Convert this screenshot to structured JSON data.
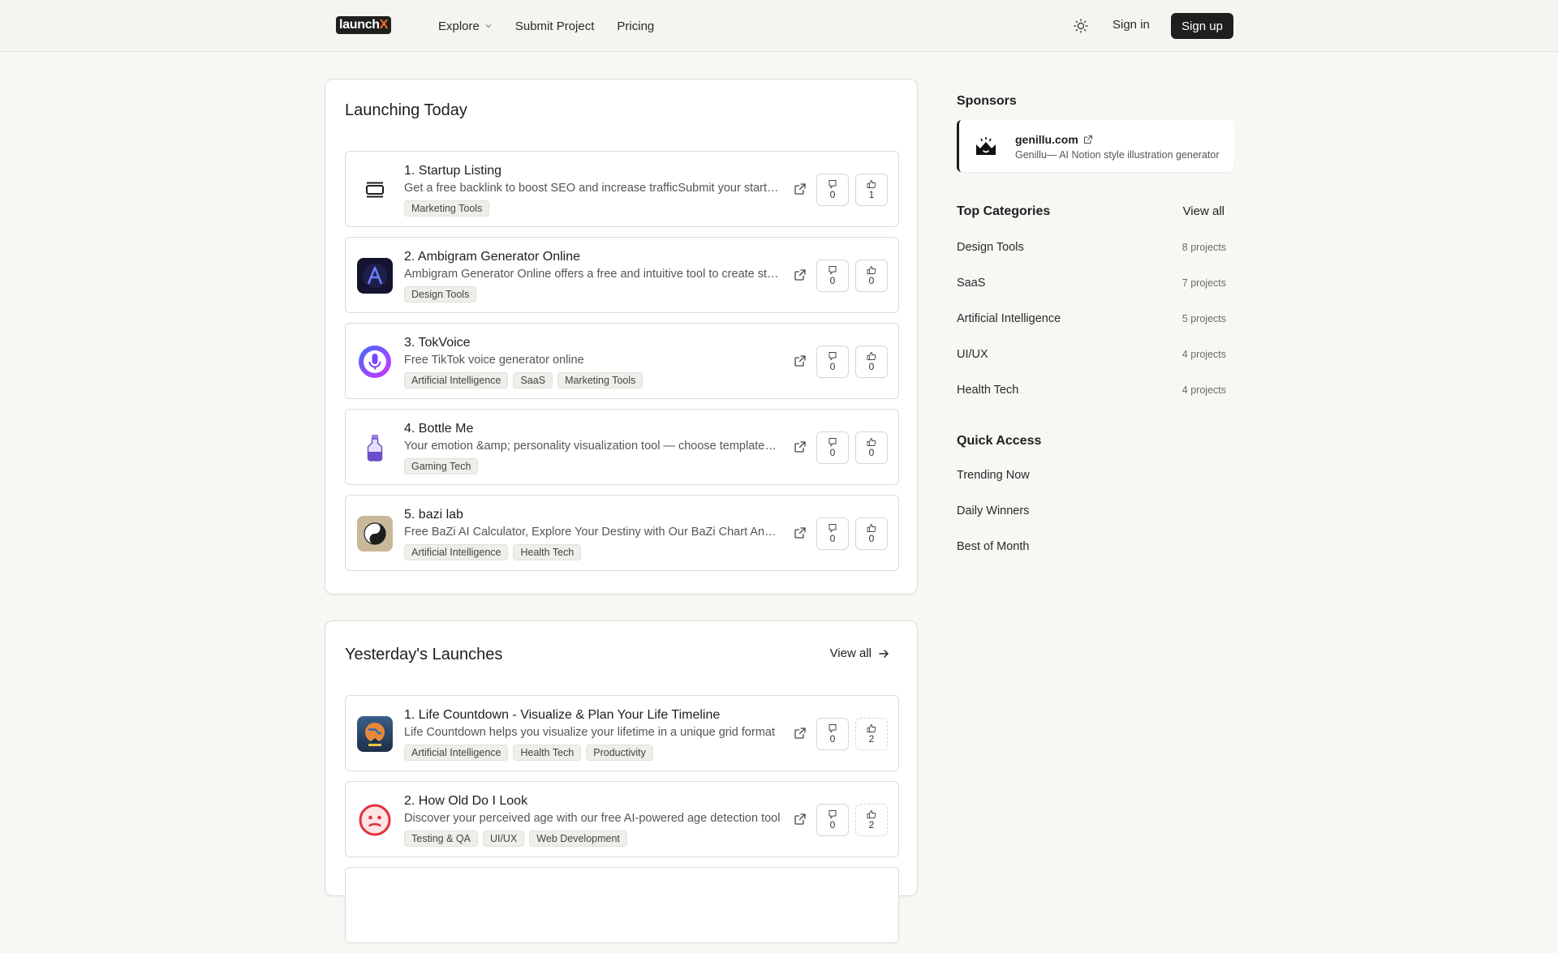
{
  "header": {
    "logo_text": "launch",
    "logo_accent": "X",
    "nav": [
      {
        "label": "Explore"
      },
      {
        "label": "Submit Project"
      },
      {
        "label": "Pricing"
      }
    ],
    "signin_label": "Sign in",
    "signup_label": "Sign up"
  },
  "today": {
    "title": "Launching Today",
    "items": [
      {
        "title": "1. Startup Listing",
        "desc": "Get a free backlink to boost SEO and increase trafficSubmit your startup to our directory and get a free backlink",
        "tags": [
          "Marketing Tools"
        ],
        "comments": "0",
        "upvotes": "1",
        "icon": "list-icon"
      },
      {
        "title": "2. Ambigram Generator Online",
        "desc": "Ambigram Generator Online offers a free and intuitive tool to create stunning ambigrams",
        "tags": [
          "Design Tools"
        ],
        "comments": "0",
        "upvotes": "0",
        "icon": "ambigram-icon"
      },
      {
        "title": "3. TokVoice",
        "desc": "Free TikTok voice generator online",
        "tags": [
          "Artificial Intelligence",
          "SaaS",
          "Marketing Tools"
        ],
        "comments": "0",
        "upvotes": "0",
        "icon": "microphone-icon"
      },
      {
        "title": "4. Bottle Me",
        "desc": "Your emotion &amp; personality visualization tool — choose templates and share your bottle",
        "tags": [
          "Gaming Tech"
        ],
        "comments": "0",
        "upvotes": "0",
        "icon": "bottle-icon"
      },
      {
        "title": "5. bazi lab",
        "desc": "Free BaZi AI Calculator, Explore Your Destiny with Our BaZi Chart Analysis",
        "tags": [
          "Artificial Intelligence",
          "Health Tech"
        ],
        "comments": "0",
        "upvotes": "0",
        "icon": "yin-yang-icon"
      }
    ]
  },
  "yesterday": {
    "title": "Yesterday's Launches",
    "view_all": "View all",
    "items": [
      {
        "title": "1. Life Countdown - Visualize & Plan Your Life Timeline",
        "desc": "Life Countdown helps you visualize your lifetime in a unique grid format",
        "tags": [
          "Artificial Intelligence",
          "Health Tech",
          "Productivity"
        ],
        "comments": "0",
        "upvotes": "2",
        "icon": "globe-icon"
      },
      {
        "title": "2. How Old Do I Look",
        "desc": "Discover your perceived age with our free AI-powered age detection tool",
        "tags": [
          "Testing & QA",
          "UI/UX",
          "Web Development"
        ],
        "comments": "0",
        "upvotes": "2",
        "icon": "face-icon"
      }
    ]
  },
  "sidebar": {
    "sponsors_title": "Sponsors",
    "sponsor": {
      "name": "genillu.com",
      "desc": "Genillu— AI Notion style illustration generator"
    },
    "top_categories_title": "Top Categories",
    "view_all": "View all",
    "categories": [
      {
        "name": "Design Tools",
        "count": "8 projects"
      },
      {
        "name": "SaaS",
        "count": "7 projects"
      },
      {
        "name": "Artificial Intelligence",
        "count": "5 projects"
      },
      {
        "name": "UI/UX",
        "count": "4 projects"
      },
      {
        "name": "Health Tech",
        "count": "4 projects"
      }
    ],
    "quick_access_title": "Quick Access",
    "quick_access": [
      {
        "label": "Trending Now"
      },
      {
        "label": "Daily Winners"
      },
      {
        "label": "Best of Month"
      }
    ]
  },
  "colors": {
    "accent": "#ff6a1a",
    "dark": "#1e1e1e",
    "background": "#f8f7f4"
  }
}
